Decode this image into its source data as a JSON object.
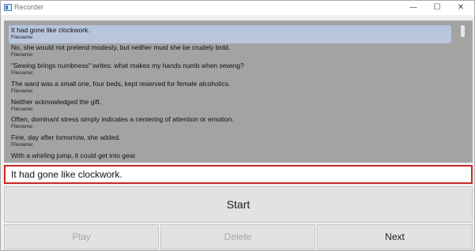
{
  "window": {
    "title": "Recorder",
    "controls": {
      "minimize": "—",
      "maximize": "☐",
      "close": "✕"
    }
  },
  "list": {
    "items": [
      {
        "text": "It had gone like clockwork.",
        "filename_label": "Filename:",
        "selected": true
      },
      {
        "text": "No, she would not pretend modesty, but neither must she be crudely bold.",
        "filename_label": "Filename:",
        "selected": false
      },
      {
        "text": "\"Sewing brings numbness\" writes: what makes my hands numb when sewing?",
        "filename_label": "Filename:",
        "selected": false
      },
      {
        "text": "The ward was a small one, four beds, kept reserved for female alcoholics.",
        "filename_label": "Filename:",
        "selected": false
      },
      {
        "text": "Neither acknowledged the gift.",
        "filename_label": "Filename:",
        "selected": false
      },
      {
        "text": "Often, dominant stress simply indicates a centering of attention or emotion.",
        "filename_label": "Filename:",
        "selected": false
      },
      {
        "text": "Fine, day after tomorrow, she added.",
        "filename_label": "Filename:",
        "selected": false
      },
      {
        "text": "With a whirling jump, it could get into gear.",
        "filename_label": "",
        "selected": false
      }
    ]
  },
  "input": {
    "value": "It had gone like clockwork."
  },
  "buttons": {
    "start": "Start",
    "play": "Play",
    "delete": "Delete",
    "next": "Next"
  }
}
